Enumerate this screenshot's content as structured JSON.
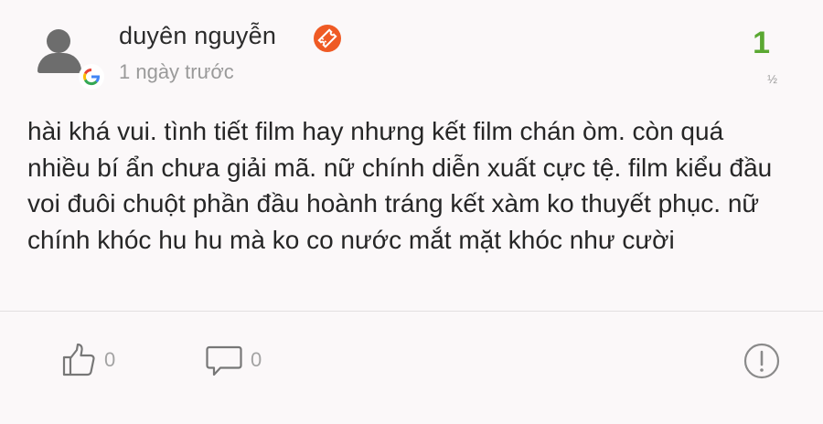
{
  "review": {
    "author": "duyên nguyễn",
    "time": "1 ngày trước",
    "rating": "1",
    "page_indicator": "½",
    "text": "hài khá vui. tình tiết film hay nhưng kết film chán òm. còn quá nhiều bí ẩn chưa giải mã. nữ chính diễn xuất cực tệ. film kiểu đầu voi đuôi chuột phần đầu hoành tráng kết xàm ko thuyết phục. nữ chính khóc hu hu mà ko co nước mắt mặt khóc như cười",
    "rating_color": "#5aa832"
  },
  "actions": {
    "likes": "0",
    "comments": "0"
  },
  "icons": {
    "avatar": "user-avatar-icon",
    "source": "google-icon",
    "badge": "ticket-badge-icon",
    "like": "thumbs-up-icon",
    "comment": "comment-icon",
    "report": "report-icon"
  }
}
